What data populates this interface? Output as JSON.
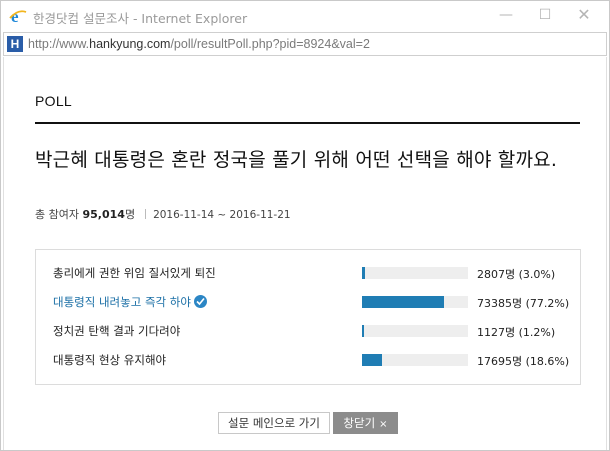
{
  "window": {
    "title": "한경닷컴 설문조사 - Internet Explorer",
    "url_prefix": "http://www.",
    "url_domain": "hankyung.com",
    "url_path": "/poll/resultPoll.php?pid=8924&val=2"
  },
  "poll": {
    "section_label": "POLL",
    "question": "박근혜 대통령은 혼란 정국을 풀기 위해 어떤 선택을 해야 할까요.",
    "participants_label": "총 참여자",
    "participants_count": "95,014",
    "participants_unit": "명",
    "period": "2016-11-14 ~ 2016-11-21",
    "results": [
      {
        "label": "총리에게 권한 위임 질서있게 퇴진",
        "value": "2807명 (3.0%)",
        "percent": 3.0,
        "selected": false
      },
      {
        "label": "대통령직 내려놓고 즉각 하야",
        "value": "73385명 (77.2%)",
        "percent": 77.2,
        "selected": true
      },
      {
        "label": "정치권 탄핵 결과 기다려야",
        "value": "1127명 (1.2%)",
        "percent": 1.2,
        "selected": false
      },
      {
        "label": "대통령직 현상 유지해야",
        "value": "17695명 (18.6%)",
        "percent": 18.6,
        "selected": false
      }
    ]
  },
  "buttons": {
    "main_label": "설문 메인으로 가기",
    "close_label": "창닫기",
    "close_symbol": "×"
  },
  "colors": {
    "bar": "#1f7db4",
    "track": "#eeeeee",
    "selected_text": "#1b6fa6",
    "close_button": "#8c8c8c"
  }
}
